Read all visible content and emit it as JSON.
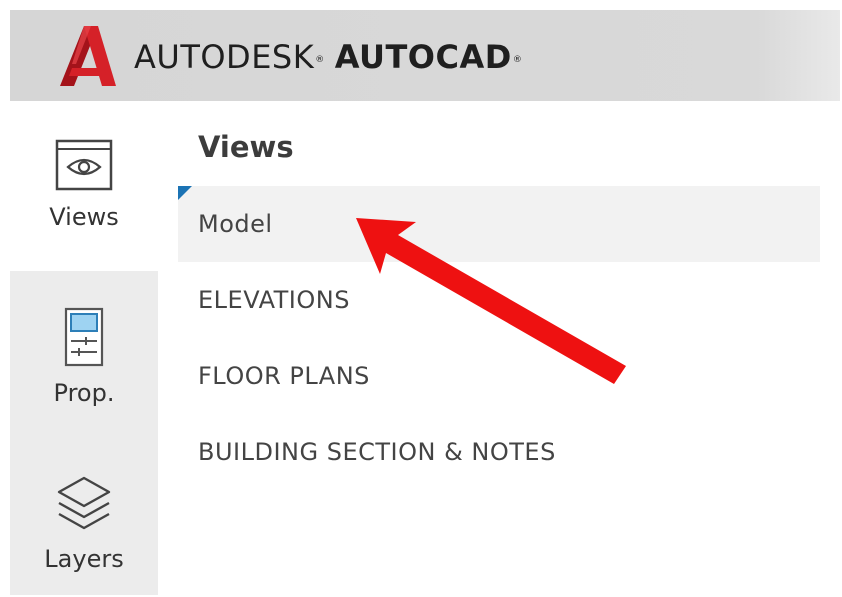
{
  "header": {
    "brand_left": "AUTODESK",
    "brand_right": "AUTOCAD",
    "trademark": "®"
  },
  "sidebar": {
    "items": [
      {
        "label": "Views",
        "icon": "eye-icon"
      },
      {
        "label": "Prop.",
        "icon": "properties-icon"
      },
      {
        "label": "Layers",
        "icon": "layers-icon"
      }
    ]
  },
  "panel": {
    "title": "Views",
    "items": [
      {
        "label": "Model",
        "selected": true
      },
      {
        "label": "ELEVATIONS"
      },
      {
        "label": "FLOOR PLANS"
      },
      {
        "label": "BUILDING SECTION & NOTES"
      }
    ]
  },
  "colors": {
    "brand_red": "#c8171f",
    "selection_marker": "#1b73b4",
    "annotation_arrow": "#ee1111"
  }
}
